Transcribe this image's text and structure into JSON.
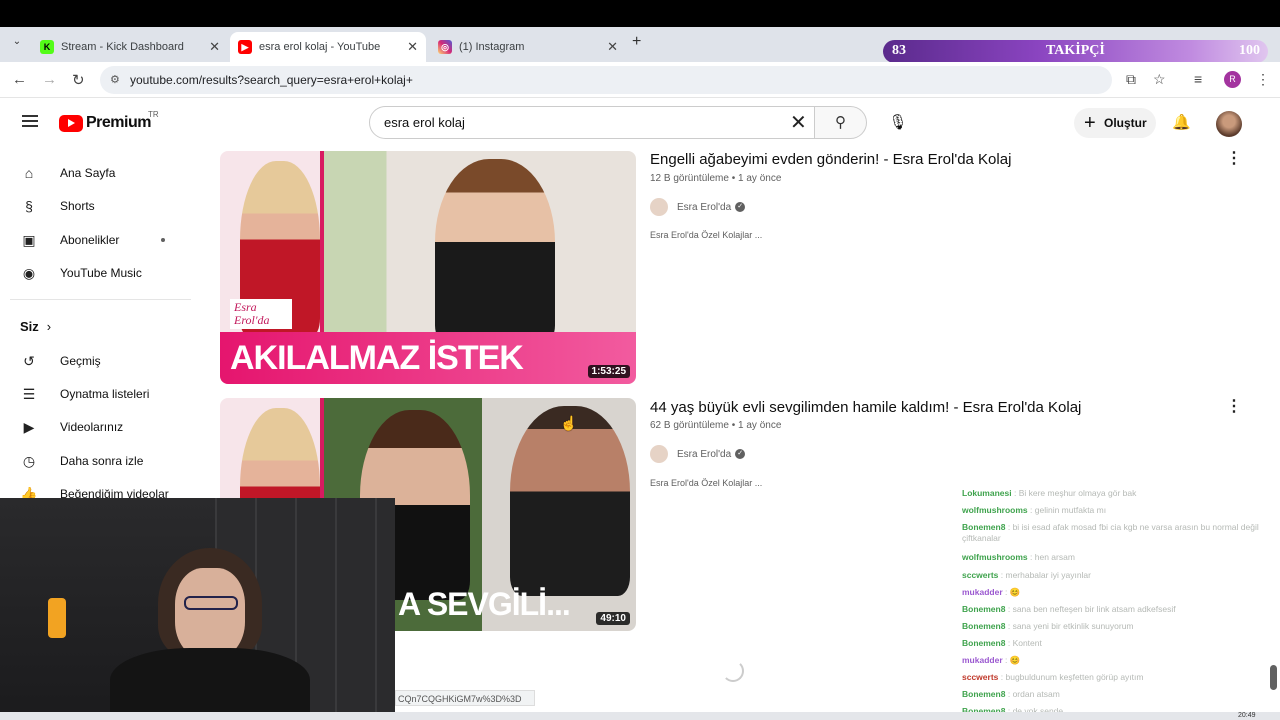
{
  "browser": {
    "tabs": [
      {
        "label": "Stream - Kick Dashboard",
        "color": "#53fc18"
      },
      {
        "label": "esra erol kolaj - YouTube",
        "color": "#ff0000"
      },
      {
        "label": "(1) Instagram",
        "color": "#d62976"
      }
    ],
    "url": "youtube.com/results?search_query=esra+erol+kolaj+",
    "profile_initial": "R"
  },
  "overlay": {
    "follower_current": "83",
    "follower_label": "TAKİPÇİ",
    "follower_goal": "100"
  },
  "youtube": {
    "logo_text": "Premium",
    "region": "TR",
    "search_value": "esra erol kolaj",
    "create_label": "Oluştur"
  },
  "sidebar": {
    "items": [
      {
        "label": "Ana Sayfa",
        "icon": "home-icon"
      },
      {
        "label": "Shorts",
        "icon": "shorts-icon"
      },
      {
        "label": "Abonelikler",
        "icon": "subscriptions-icon"
      },
      {
        "label": "YouTube Music",
        "icon": "music-icon"
      }
    ],
    "you_label": "Siz",
    "you_items": [
      {
        "label": "Geçmiş",
        "icon": "history-icon"
      },
      {
        "label": "Oynatma listeleri",
        "icon": "playlists-icon"
      },
      {
        "label": "Videolarınız",
        "icon": "your-videos-icon"
      },
      {
        "label": "Daha sonra izle",
        "icon": "watch-later-icon"
      },
      {
        "label": "Beğendiğim videolar",
        "icon": "liked-icon"
      }
    ]
  },
  "videos": [
    {
      "title": "Engelli ağabeyimi evden gönderin! - Esra Erol'da Kolaj",
      "views": "12 B görüntüleme",
      "age": "1 ay önce",
      "channel": "Esra Erol'da",
      "description": "Esra Erol'da Özel Kolajlar ...",
      "thumb_text": "AKILALMAZ İSTEK",
      "duration": "1:53:25",
      "brand": "Esra Erol'da"
    },
    {
      "title": "44 yaş büyük evli sevgilimden hamile kaldım! - Esra Erol'da Kolaj",
      "views": "62 B görüntüleme",
      "age": "1 ay önce",
      "channel": "Esra Erol'da",
      "description": "Esra Erol'da Özel Kolajlar ...",
      "thumb_text": "A SEVGİLİ...",
      "duration": "49:10"
    }
  ],
  "status_url": "CQn7CQGHKiGM7w%3D%3D",
  "chat": [
    {
      "user": "Lokumanesi",
      "msg": "Bi kere meşhur olmaya gör bak",
      "color": "#3fa34d"
    },
    {
      "user": "wolfmushrooms",
      "msg": "gelinin mutfakta mı",
      "color": "#3fa34d"
    },
    {
      "user": "Bonemen8",
      "msg": "bi isi esad afak mosad fbi cia kgb ne varsa arasın bu normal değil çiftkanalar",
      "color": "#3fa34d"
    },
    {
      "user": "wolfmushrooms",
      "msg": "hen arsam",
      "color": "#3fa34d"
    },
    {
      "user": "sccwerts",
      "msg": "merhabalar iyi yayınlar",
      "color": "#3fa34d"
    },
    {
      "user": "mukadder",
      "msg": "😊",
      "color": "#9b59d0"
    },
    {
      "user": "Bonemen8",
      "msg": "sana ben nefteşen bir link atsam adkefsesif",
      "color": "#3fa34d"
    },
    {
      "user": "Bonemen8",
      "msg": "sana yeni bir etkinlik sunuyorum",
      "color": "#3fa34d"
    },
    {
      "user": "Bonemen8",
      "msg": "Kontent",
      "color": "#3fa34d"
    },
    {
      "user": "mukadder",
      "msg": "😊",
      "color": "#9b59d0"
    },
    {
      "user": "sccwerts",
      "msg": "bugbuldunum keşfetten görüp ayıtım",
      "color": "#c0392b"
    },
    {
      "user": "Bonemen8",
      "msg": "ordan atsam",
      "color": "#3fa34d"
    },
    {
      "user": "Bonemen8",
      "msg": "de yok sende",
      "color": "#3fa34d"
    }
  ],
  "clock": "20:49"
}
